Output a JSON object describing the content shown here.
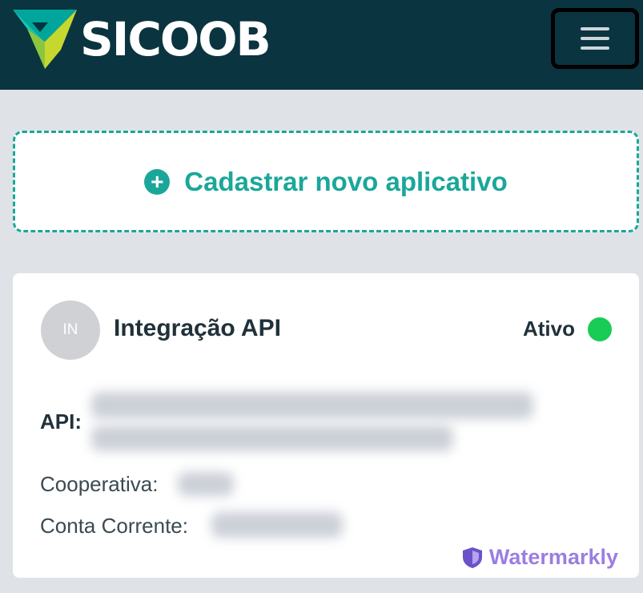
{
  "header": {
    "logo_text": "SICOOB",
    "logo_icon": "sicoob-logo-icon",
    "menu_icon": "hamburger-menu-icon",
    "background_color": "#0a3440"
  },
  "new_app": {
    "label": "Cadastrar novo aplicativo",
    "icon": "plus-circle-icon",
    "accent_color": "#1aa79a"
  },
  "app_card": {
    "avatar_initials": "IN",
    "name": "Integração API",
    "status": "Ativo",
    "status_color": "#18cc56",
    "api_label": "API:",
    "cooperativa_label": "Cooperativa:",
    "conta_corrente_label": "Conta Corrente:"
  },
  "watermark": {
    "text": "Watermarkly",
    "icon": "shield-icon",
    "color": "#9b7ee0"
  }
}
